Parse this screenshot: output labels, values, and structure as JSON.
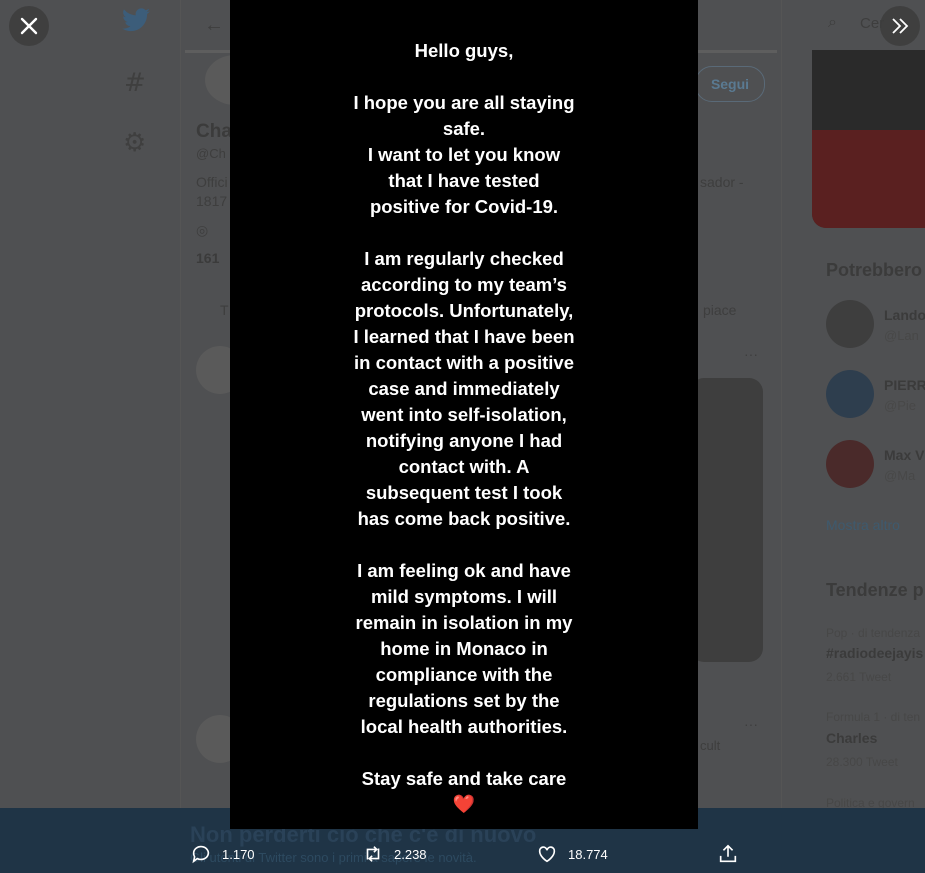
{
  "background": {
    "left_nav": {
      "icons": [
        "twitter-bird-icon",
        "hashtag-icon",
        "settings-icon"
      ]
    },
    "profile": {
      "name_fragment": "Cha",
      "handle_fragment": "@Ch",
      "bio_fragment_1": "Offici",
      "bio_fragment_2": "1817",
      "bio_right_fragment": "sador -",
      "stat_fragment": "161",
      "follow_label": "Segui",
      "tab_fragment_left": "T",
      "tab_fragment_right": "piace",
      "tweet_more_1": "···",
      "tweet_more_2": "···",
      "tweet_fragment": "cult"
    },
    "right_column": {
      "search_fragment": "Cer",
      "who_to_follow_title": "Potrebbero",
      "suggestions": [
        {
          "name": "Lando",
          "handle": "@Lan"
        },
        {
          "name": "PIERR",
          "handle": "@Pie"
        },
        {
          "name": "Max V",
          "handle": "@Ma"
        }
      ],
      "show_more": "Mostra altro",
      "trends_title": "Tendenze p",
      "trends": [
        {
          "context": "Pop · di tendenza",
          "name": "#radiodeejayis",
          "count": "2.661 Tweet"
        },
        {
          "context": "Formula 1 · di ten",
          "name": "Charles",
          "count": "28.300 Tweet"
        },
        {
          "context": "Politica e govern",
          "name": "",
          "count": ""
        }
      ]
    },
    "banner": {
      "title": "Non perderti ciò che c'è di nuovo",
      "subtitle": "Gli utenti di Twitter sono i primi a sapere le novità."
    }
  },
  "story": {
    "paragraphs": [
      "Hello guys,",
      "I hope you are all staying\nsafe.\nI want to let you know\nthat I have tested\npositive for Covid-19.",
      "I am regularly checked\naccording to my team’s\nprotocols. Unfortunately,\nI learned that I have been\nin contact with a positive\ncase and immediately\nwent into self-isolation,\nnotifying anyone I had\ncontact with. A\nsubsequent test I took\nhas come back positive.",
      "I am feeling ok and have\nmild symptoms. I will\nremain in isolation in my\nhome in Monaco in\ncompliance with the\nregulations set by the\nlocal health authorities.",
      "Stay safe and take care"
    ],
    "emoji": "❤️"
  },
  "viewer": {
    "close_icon": "close-icon",
    "expand_icon": "double-chevron-right-icon"
  },
  "actions": {
    "replies": "1.170",
    "retweets": "2.238",
    "likes": "18.774",
    "share_icon": "share-icon"
  }
}
